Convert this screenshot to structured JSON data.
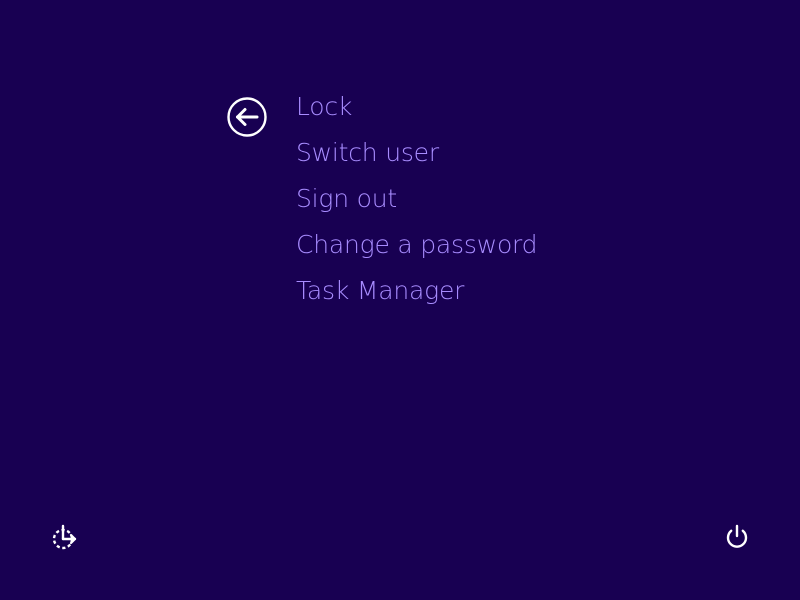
{
  "menu": {
    "items": [
      {
        "label": "Lock"
      },
      {
        "label": "Switch user"
      },
      {
        "label": "Sign out"
      },
      {
        "label": "Change a password"
      },
      {
        "label": "Task Manager"
      }
    ]
  },
  "icons": {
    "back": "back-arrow-icon",
    "ease_of_access": "ease-of-access-icon",
    "power": "power-icon"
  },
  "colors": {
    "background": "#180052",
    "menu_text": "#a88cff",
    "icon": "#ffffff"
  }
}
